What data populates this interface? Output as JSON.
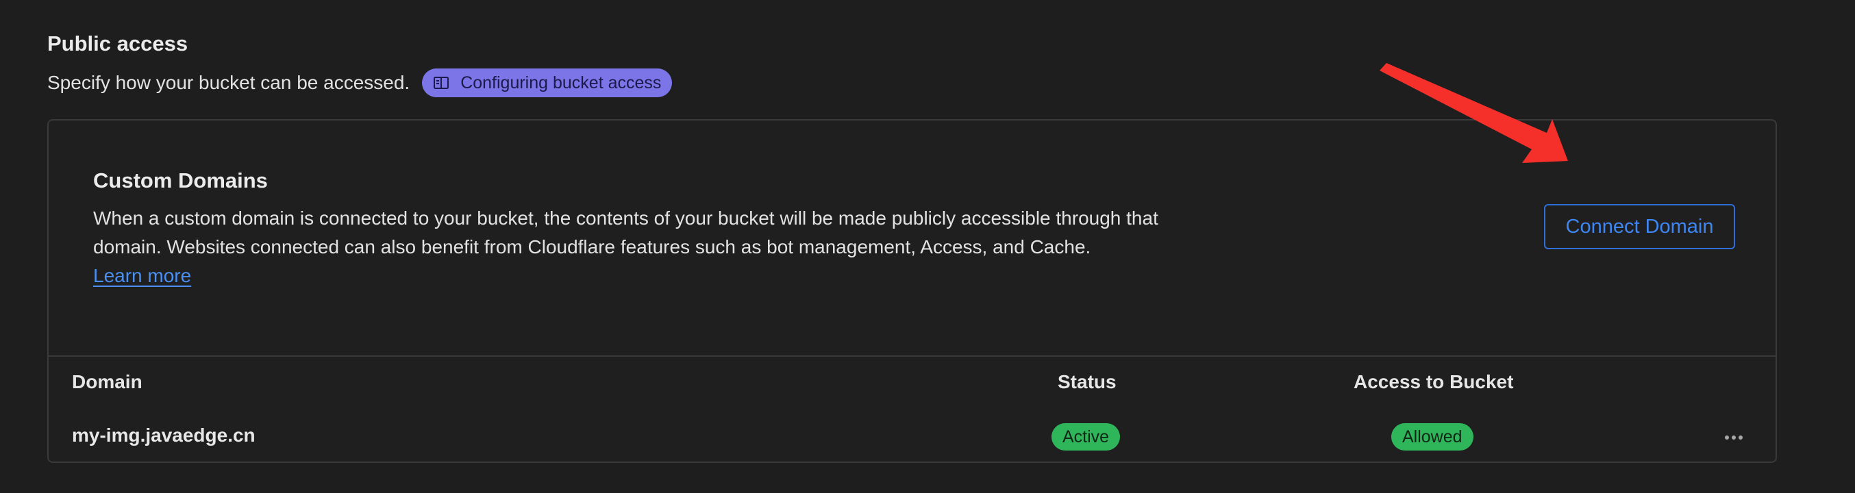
{
  "public_access": {
    "title": "Public access",
    "description": "Specify how your bucket can be accessed.",
    "doc_link_label": "Configuring bucket access",
    "doc_link_icon": "book-icon"
  },
  "custom_domains": {
    "title": "Custom Domains",
    "description": "When a custom domain is connected to your bucket, the contents of your bucket will be made publicly accessible through that domain. Websites connected can also benefit from Cloudflare features such as bot management, Access, and Cache.",
    "learn_more_label": "Learn more",
    "connect_button_label": "Connect Domain"
  },
  "table": {
    "headers": {
      "domain": "Domain",
      "status": "Status",
      "access": "Access to Bucket"
    },
    "rows": [
      {
        "domain": "my-img.javaedge.cn",
        "status": "Active",
        "access": "Allowed",
        "actions_icon": "more-horizontal-icon"
      }
    ]
  },
  "colors": {
    "background": "#1e1e1f",
    "accent_blue": "#3f86f0",
    "badge_purple": "#7b75e8",
    "status_green": "#2fb65a",
    "annotation_arrow": "#f5302a"
  }
}
